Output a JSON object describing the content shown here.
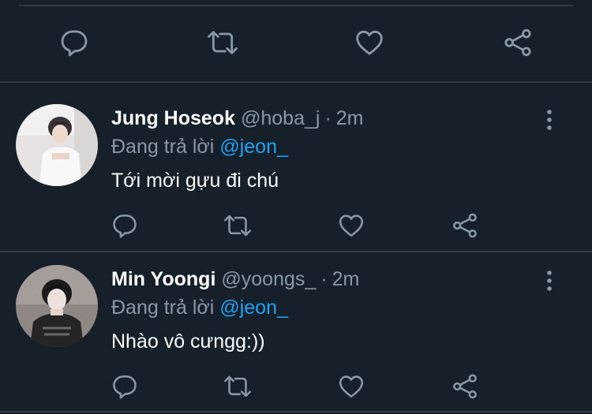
{
  "colors": {
    "background": "#15202b",
    "divider": "#2f3a45",
    "icon": "#8899a6",
    "name": "#ffffff",
    "secondary": "#8899a6",
    "link": "#1da1f2"
  },
  "main_tweet": {
    "actions": [
      {
        "icon": "comment-icon"
      },
      {
        "icon": "retweet-icon"
      },
      {
        "icon": "heart-icon"
      },
      {
        "icon": "share-icon"
      }
    ]
  },
  "replies": [
    {
      "avatar_icon": "avatar",
      "name": "Jung Hoseok",
      "handle": "@hoba_j",
      "separator": "·",
      "time": "2m",
      "replying_to_label": "Đang trả lời",
      "replying_to_handle": "@jeon_",
      "text": "Tới mời gựu đi chú",
      "more_icon": "more-vertical-icon",
      "actions": [
        {
          "icon": "comment-icon"
        },
        {
          "icon": "retweet-icon"
        },
        {
          "icon": "heart-icon"
        },
        {
          "icon": "share-icon"
        }
      ]
    },
    {
      "avatar_icon": "avatar",
      "name": "Min Yoongi",
      "handle": "@yoongs_",
      "separator": "·",
      "time": "2m",
      "replying_to_label": "Đang trả lời",
      "replying_to_handle": "@jeon_",
      "text": "Nhào vô cưngg:))",
      "more_icon": "more-vertical-icon",
      "actions": [
        {
          "icon": "comment-icon"
        },
        {
          "icon": "retweet-icon"
        },
        {
          "icon": "heart-icon"
        },
        {
          "icon": "share-icon"
        }
      ]
    }
  ]
}
